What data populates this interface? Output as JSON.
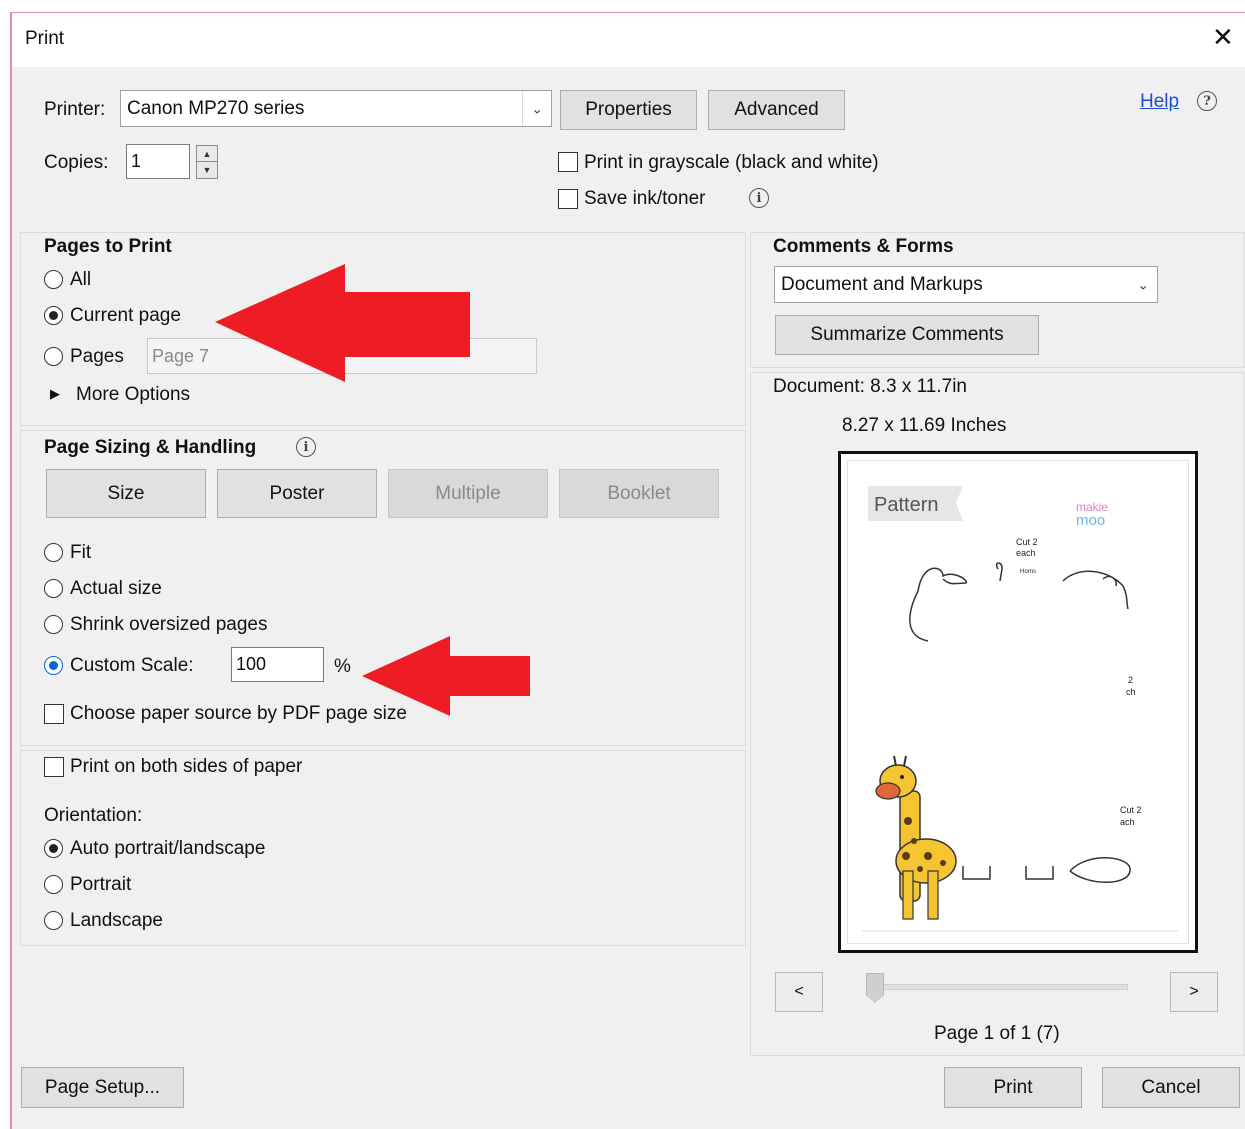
{
  "window": {
    "title": "Print"
  },
  "printer": {
    "label": "Printer:",
    "selected": "Canon MP270 series",
    "properties_button": "Properties",
    "advanced_button": "Advanced",
    "help_link": "Help"
  },
  "copies": {
    "label": "Copies:",
    "value": "1"
  },
  "options": {
    "grayscale_label": "Print in grayscale (black and white)",
    "grayscale_checked": false,
    "save_ink_label": "Save ink/toner",
    "save_ink_checked": false
  },
  "pages_to_print": {
    "title": "Pages to Print",
    "all_label": "All",
    "current_label": "Current page",
    "pages_label": "Pages",
    "pages_placeholder": "Page 7",
    "more_options_label": "More Options",
    "selected": "current"
  },
  "page_sizing": {
    "title": "Page Sizing & Handling",
    "tabs": [
      {
        "label": "Size",
        "enabled": true
      },
      {
        "label": "Poster",
        "enabled": true
      },
      {
        "label": "Multiple",
        "enabled": false
      },
      {
        "label": "Booklet",
        "enabled": false
      }
    ],
    "fit_label": "Fit",
    "actual_label": "Actual size",
    "shrink_label": "Shrink oversized pages",
    "custom_label": "Custom Scale:",
    "custom_value": "100",
    "percent": "%",
    "selected": "custom",
    "paper_source_label": "Choose paper source by PDF page size",
    "paper_source_checked": false
  },
  "duplex": {
    "label": "Print on both sides of paper",
    "checked": false
  },
  "orientation": {
    "title": "Orientation:",
    "auto_label": "Auto portrait/landscape",
    "portrait_label": "Portrait",
    "landscape_label": "Landscape",
    "selected": "auto"
  },
  "comments_forms": {
    "title": "Comments & Forms",
    "selected": "Document and Markups",
    "summarize_button": "Summarize Comments"
  },
  "preview": {
    "document_size": "Document: 8.3 x 11.7in",
    "paper_size": "8.27 x 11.69 Inches",
    "prev_button": "<",
    "next_button": ">",
    "page_status": "Page 1 of 1 (7)",
    "page_content": {
      "heading": "Pattern",
      "logo_top": "makie",
      "logo_bottom": "moo",
      "cut_label_1": "Cut 2",
      "cut_label_2": "each",
      "horns_label": "Horns",
      "side_label_1": "2",
      "side_label_2": "ch",
      "side_label_3": "Cut 2",
      "side_label_4": "ach"
    }
  },
  "footer": {
    "page_setup_button": "Page Setup...",
    "print_button": "Print",
    "cancel_button": "Cancel"
  },
  "colors": {
    "annotation_arrow": "#ee1c24",
    "radio_accent": "#0a64d6"
  }
}
